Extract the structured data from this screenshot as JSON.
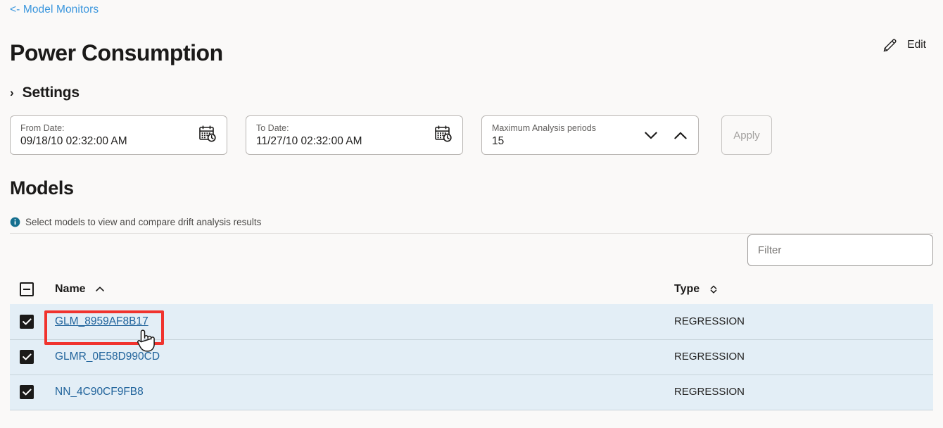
{
  "breadcrumb": {
    "back_label": "<- Model Monitors",
    "icon": "arrow-left-icon"
  },
  "header": {
    "title": "Power Consumption",
    "edit_label": "Edit",
    "edit_icon": "pencil-icon"
  },
  "settings": {
    "title": "Settings",
    "chevron": "›",
    "chevron_icon": "chevron-right-icon",
    "expanded": false,
    "fields": {
      "from_date": {
        "label": "From Date:",
        "value": "09/18/10 02:32:00 AM",
        "icon": "calendar-clock-icon"
      },
      "to_date": {
        "label": "To Date:",
        "value": "11/27/10 02:32:00 AM",
        "icon": "calendar-clock-icon"
      },
      "max_periods": {
        "label": "Maximum Analysis periods",
        "value": "15",
        "decrement_icon": "chevron-down-icon",
        "increment_icon": "chevron-up-icon"
      }
    },
    "apply_label": "Apply",
    "apply_disabled": true
  },
  "models": {
    "title": "Models",
    "hint": "Select models to view and compare drift analysis results",
    "hint_icon": "info-icon",
    "filter": {
      "value": "",
      "placeholder": "Filter"
    },
    "table": {
      "select_all_state": "indeterminate",
      "columns": [
        {
          "key": "name",
          "label": "Name",
          "sort": "asc",
          "sort_icon": "chevron-up-icon"
        },
        {
          "key": "type",
          "label": "Type",
          "sort": "none",
          "sort_icon": "sort-updown-icon"
        }
      ],
      "rows": [
        {
          "checked": true,
          "name": "GLM_8959AF8B17",
          "type": "REGRESSION",
          "hovered": true
        },
        {
          "checked": true,
          "name": "GLMR_0E58D990CD",
          "type": "REGRESSION",
          "hovered": false
        },
        {
          "checked": true,
          "name": "NN_4C90CF9FB8",
          "type": "REGRESSION",
          "hovered": false
        }
      ]
    }
  },
  "annotation": {
    "highlight_color": "#f0332e",
    "target": "GLM_8959AF8B17",
    "cursor_icon": "pointer-hand-cursor"
  },
  "colors": {
    "page_background": "#faf9f8",
    "link": "#3a96dd",
    "table_row_background": "#e3eef6",
    "table_link": "#20639b",
    "info_icon": "#156f8f",
    "highlight": "#f0332e"
  }
}
